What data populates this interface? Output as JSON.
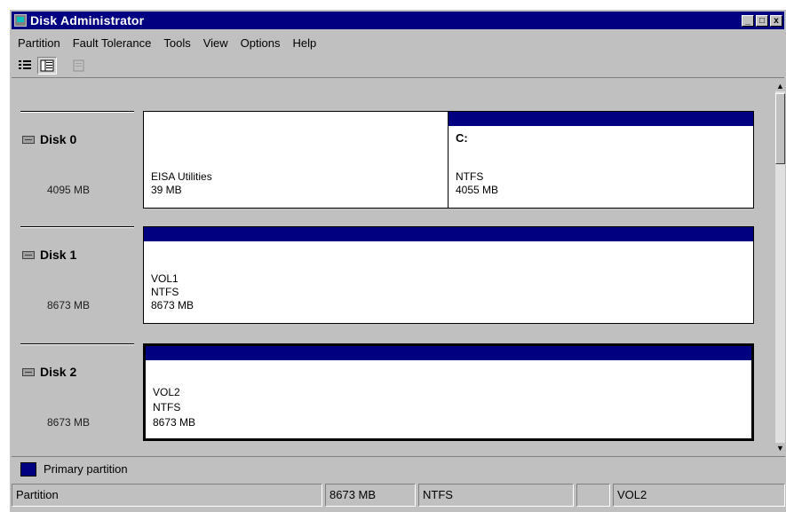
{
  "window": {
    "title": "Disk Administrator",
    "controls": {
      "minimize": "_",
      "maximize": "□",
      "close": "x"
    }
  },
  "menu": [
    {
      "label": "Partition"
    },
    {
      "label": "Fault Tolerance"
    },
    {
      "label": "Tools"
    },
    {
      "label": "View"
    },
    {
      "label": "Options"
    },
    {
      "label": "Help"
    }
  ],
  "toolbar": [
    {
      "icon": "disk-view-icon",
      "pressed": false
    },
    {
      "icon": "volume-view-icon",
      "pressed": true
    },
    {
      "icon": "properties-icon",
      "pressed": false,
      "disabled": true
    }
  ],
  "disks": [
    {
      "label": "Disk 0",
      "size": "4095 MB",
      "partitions": [
        {
          "bar": false,
          "letter": "",
          "lines": [
            "EISA Utilities",
            "39 MB"
          ]
        },
        {
          "bar": true,
          "letter": "C:",
          "lines": [
            "NTFS",
            "4055 MB"
          ]
        }
      ]
    },
    {
      "label": "Disk 1",
      "size": "8673 MB",
      "partitions": [
        {
          "bar": true,
          "letter": "",
          "lines": [
            "VOL1",
            "NTFS",
            "8673 MB"
          ]
        }
      ]
    },
    {
      "label": "Disk 2",
      "size": "8673 MB",
      "selected": true,
      "partitions": [
        {
          "bar": true,
          "letter": "",
          "lines": [
            "VOL2",
            "NTFS",
            "8673 MB"
          ]
        }
      ]
    }
  ],
  "legend": {
    "label": "Primary partition",
    "color": "#000080"
  },
  "status": {
    "type": "Partition",
    "size": "8673 MB",
    "filesystem": "NTFS",
    "letter": "",
    "volume": "VOL2"
  }
}
